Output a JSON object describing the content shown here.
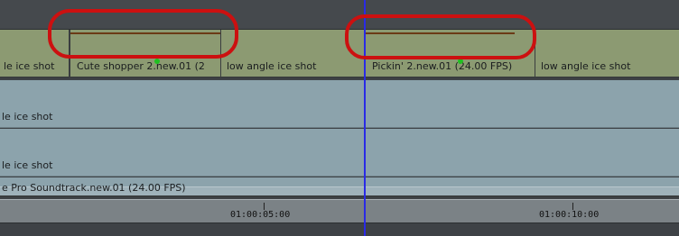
{
  "colors": {
    "window_bg": "#3e4246",
    "video_track_bg": "#8c9a72",
    "audio_track_bg": "#8ca3ac",
    "ruler_bg": "#7b8286",
    "playhead": "#2a2ae6",
    "annotation": "#cc1010",
    "render_marker": "#20c020"
  },
  "video_track": {
    "clips": [
      {
        "label": "le ice shot"
      },
      {
        "label": "Cute shopper 2.new.01 (2"
      },
      {
        "label": "low angle ice shot"
      },
      {
        "label": "Pickin' 2.new.01 (24.00 FPS)"
      },
      {
        "label": "low angle ice shot"
      }
    ]
  },
  "audio_tracks": [
    {
      "label": "le ice shot"
    },
    {
      "label": "le ice shot"
    }
  ],
  "soundtrack": {
    "label": "e Pro Soundtrack.new.01 (24.00 FPS)"
  },
  "ruler": {
    "ticks": [
      "01:00:05:00",
      "01:00:10:00"
    ]
  }
}
